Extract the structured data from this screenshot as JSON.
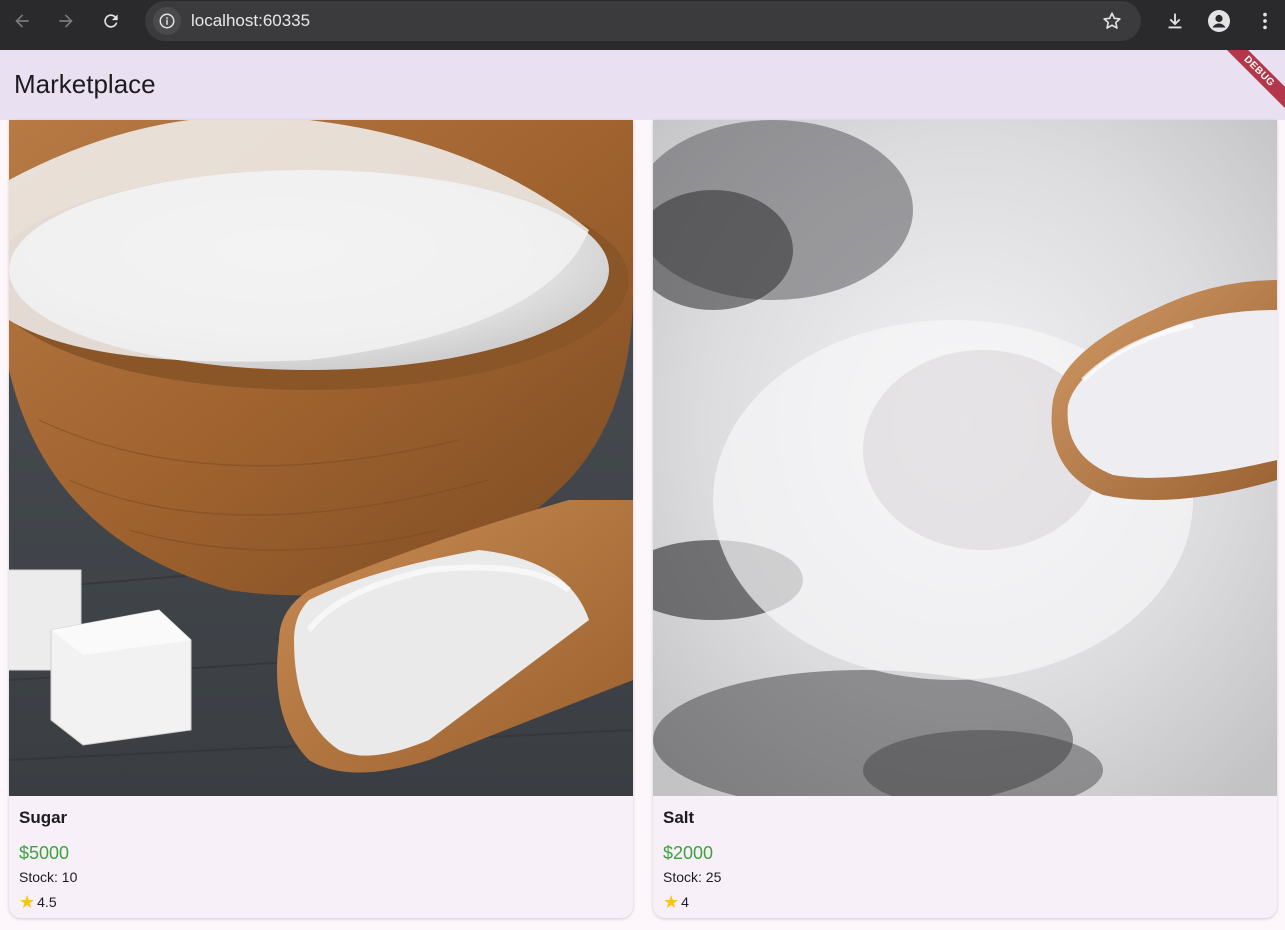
{
  "browser": {
    "url": "localhost:60335",
    "icons": [
      "back-icon",
      "forward-icon",
      "reload-icon",
      "site-info-icon",
      "bookmark-star-icon",
      "download-icon",
      "profile-icon",
      "more-menu-icon"
    ]
  },
  "app_bar": {
    "title": "Marketplace",
    "debug_label": "DEBUG",
    "background": "#e9e0f1"
  },
  "products": [
    {
      "name": "Sugar",
      "price": "$5000",
      "stock": "Stock: 10",
      "rating": "4.5",
      "image": "sugar-bowl-image"
    },
    {
      "name": "Salt",
      "price": "$2000",
      "stock": "Stock: 25",
      "rating": "4",
      "image": "salt-spoon-image"
    }
  ],
  "colors": {
    "price": "#3fa13f",
    "star": "#f5c518",
    "card_bg": "#f7f0f8",
    "ribbon": "#b3364a"
  }
}
